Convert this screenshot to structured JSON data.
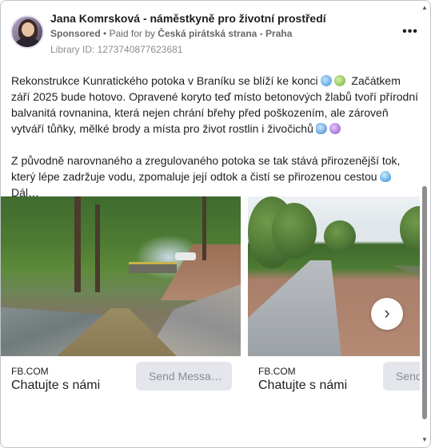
{
  "post": {
    "page_name": "Jana Komrsková - náměstkyně pro životní prostředí",
    "sponsored_label": "Sponsored",
    "paid_for_prefix": "Paid for by",
    "paid_for_by": "Česká pirátská strana - Praha",
    "library_id": "Library ID: 1273740877623681",
    "more_icon": "more-horizontal-icon",
    "more_glyph": "•••"
  },
  "body": {
    "paragraph_1_part_1": "Rekonstrukce Kunratického potoka v Braníku se blíží ke konci",
    "paragraph_1_part_2": "Začátkem září 2025 bude hotovo. Opravené koryto teď místo betonových žlabů tvoří přírodní balvanitá rovnanina, která nejen chrání břehy před poškozením, ale zároveň vytváří tůňky, mělké brody a místa pro život rostlin i živočichů",
    "paragraph_2_part_1": "Z původně narovnaného a zregulovaného potoka se tak stává přirozenější tok, který lépe zadržuje vodu, zpomaluje její odtok a čistí se přirozenou cestou",
    "paragraph_2_part_2": "Dál…",
    "emoji_icons": [
      "water-wave-icon",
      "herb-icon",
      "fish-icon",
      "flower-icon",
      "droplet-icon"
    ]
  },
  "carousel": {
    "cards": [
      {
        "domain": "FB.COM",
        "title": "Chatujte s námi",
        "button": "Send Messa…"
      },
      {
        "domain": "FB.COM",
        "title": "Chatujte s námi",
        "button": "Send"
      }
    ],
    "next_glyph": "›"
  },
  "scrollbar": {
    "up_glyph": "▲",
    "down_glyph": "▼"
  }
}
